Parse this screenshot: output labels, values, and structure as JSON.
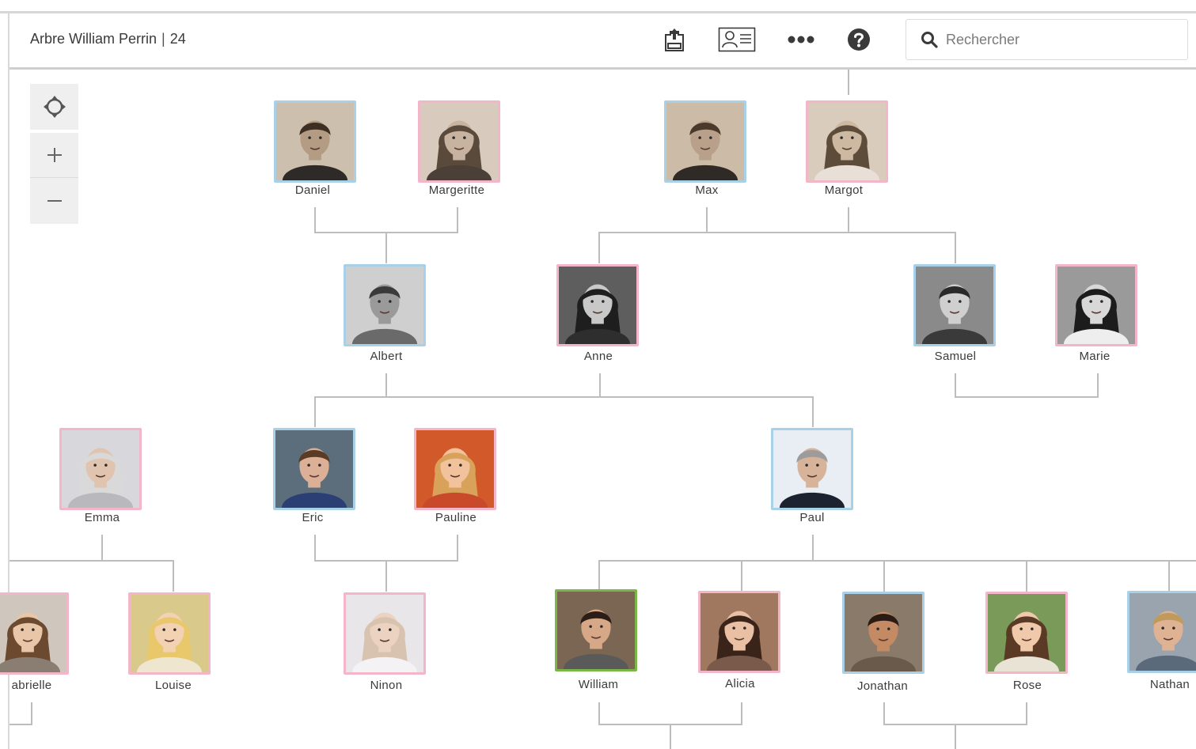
{
  "header": {
    "tree_title": "Arbre William Perrin",
    "tree_count": "24",
    "search_placeholder": "Rechercher"
  },
  "people": [
    {
      "id": "daniel",
      "name": "Daniel",
      "gender": "male",
      "skin": "#b39b84",
      "bg": "#cdbfae",
      "hair": "#3d2f24",
      "shirt": "#2e2a27"
    },
    {
      "id": "margeritte",
      "name": "Margeritte",
      "gender": "female",
      "skin": "#c7b3a0",
      "bg": "#d8cbbd",
      "hair": "#5a4a3c",
      "shirt": "#4a4038"
    },
    {
      "id": "max",
      "name": "Max",
      "gender": "male",
      "skin": "#b8a08a",
      "bg": "#cbbba7",
      "hair": "#4a3a2c",
      "shirt": "#2f2a26"
    },
    {
      "id": "margot",
      "name": "Margot",
      "gender": "female",
      "skin": "#cdb8a2",
      "bg": "#d9ccbc",
      "hair": "#5e4c3b",
      "shirt": "#e8e0d6"
    },
    {
      "id": "albert",
      "name": "Albert",
      "gender": "male",
      "skin": "#9a9a9a",
      "bg": "#cfcfcf",
      "hair": "#3a3a3a",
      "shirt": "#6a6a6a"
    },
    {
      "id": "anne",
      "name": "Anne",
      "gender": "female",
      "skin": "#c8c8c8",
      "bg": "#5e5e5e",
      "hair": "#1e1e1e",
      "shirt": "#2e2e2e"
    },
    {
      "id": "samuel",
      "name": "Samuel",
      "gender": "male",
      "skin": "#cfcfcf",
      "bg": "#8a8a8a",
      "hair": "#2a2a2a",
      "shirt": "#3a3a3a"
    },
    {
      "id": "marie",
      "name": "Marie",
      "gender": "female",
      "skin": "#d8d8d8",
      "bg": "#9a9a9a",
      "hair": "#1c1c1c",
      "shirt": "#eeeeee"
    },
    {
      "id": "emma",
      "name": "Emma",
      "gender": "female",
      "skin": "#e0c4b0",
      "bg": "#d8d8dc",
      "hair": "#d9d9d9",
      "shirt": "#b9b9bd"
    },
    {
      "id": "eric",
      "name": "Eric",
      "gender": "male",
      "skin": "#dcb096",
      "bg": "#5c6e7c",
      "hair": "#5a3b26",
      "shirt": "#2b3f75"
    },
    {
      "id": "pauline",
      "name": "Pauline",
      "gender": "female",
      "skin": "#f2c29c",
      "bg": "#d25a2a",
      "hair": "#d9a25a",
      "shirt": "#c84a2a"
    },
    {
      "id": "paul",
      "name": "Paul",
      "gender": "male",
      "skin": "#d7b39a",
      "bg": "#e8eef4",
      "hair": "#9c9c9c",
      "shirt": "#1c2230"
    },
    {
      "id": "gabrielle",
      "name": "abrielle",
      "gender": "female",
      "skin": "#e9c6a8",
      "bg": "#cfc7bd",
      "hair": "#6b4a30",
      "shirt": "#8a7e72"
    },
    {
      "id": "louise",
      "name": "Louise",
      "gender": "female",
      "skin": "#f3d2b4",
      "bg": "#d9c98a",
      "hair": "#e8c86a",
      "shirt": "#efe6d0"
    },
    {
      "id": "ninon",
      "name": "Ninon",
      "gender": "female",
      "skin": "#ecd2c0",
      "bg": "#e8e6e8",
      "hair": "#d8c2b0",
      "shirt": "#f4f2f4"
    },
    {
      "id": "william",
      "name": "William",
      "gender": "self",
      "skin": "#d6a888",
      "bg": "#7a6652",
      "hair": "#2a1e16",
      "shirt": "#5a5a5a"
    },
    {
      "id": "alicia",
      "name": "Alicia",
      "gender": "female",
      "skin": "#e9c0a4",
      "bg": "#a07860",
      "hair": "#3a241a",
      "shirt": "#7a5a4a"
    },
    {
      "id": "jonathan",
      "name": "Jonathan",
      "gender": "male",
      "skin": "#c48a64",
      "bg": "#8a7a6a",
      "hair": "#2a1c14",
      "shirt": "#6a5a4c"
    },
    {
      "id": "rose",
      "name": "Rose",
      "gender": "female",
      "skin": "#f0c8aa",
      "bg": "#7a9a5a",
      "hair": "#5a3a24",
      "shirt": "#e9e3d6"
    },
    {
      "id": "nathan",
      "name": "Nathan",
      "gender": "male",
      "skin": "#e0b294",
      "bg": "#9aa4ae",
      "hair": "#c09a5a",
      "shirt": "#5a6a7a"
    }
  ]
}
